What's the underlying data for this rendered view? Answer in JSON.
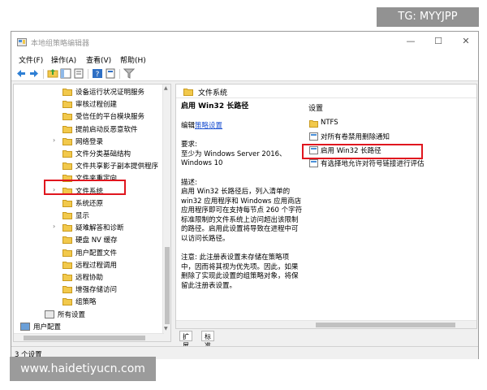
{
  "watermarks": {
    "top": "TG: MYYJPP",
    "bottom": "www.haidetiyucn.com"
  },
  "window": {
    "title": "本地组策略编辑器"
  },
  "menu": [
    "文件(F)",
    "操作(A)",
    "查看(V)",
    "帮助(H)"
  ],
  "tree": {
    "items": [
      {
        "label": "设备运行状况证明服务",
        "arrow": ""
      },
      {
        "label": "审核过程创建",
        "arrow": ""
      },
      {
        "label": "受信任的平台模块服务",
        "arrow": ""
      },
      {
        "label": "提前启动反恶意软件",
        "arrow": ""
      },
      {
        "label": "网络登录",
        "arrow": ">"
      },
      {
        "label": "文件分类基础结构",
        "arrow": ""
      },
      {
        "label": "文件共享影子副本提供程序",
        "arrow": ""
      },
      {
        "label": "文件夹重定向",
        "arrow": ""
      },
      {
        "label": "文件系统",
        "arrow": ">"
      },
      {
        "label": "系统还原",
        "arrow": ""
      },
      {
        "label": "显示",
        "arrow": ""
      },
      {
        "label": "疑难解答和诊断",
        "arrow": ">"
      },
      {
        "label": "硬盘 NV 缓存",
        "arrow": ""
      },
      {
        "label": "用户配置文件",
        "arrow": ""
      },
      {
        "label": "远程过程调用",
        "arrow": ""
      },
      {
        "label": "远程协助",
        "arrow": ""
      },
      {
        "label": "增强存储访问",
        "arrow": ""
      },
      {
        "label": "组策略",
        "arrow": ""
      },
      {
        "label": "所有设置",
        "arrow": ""
      },
      {
        "label": "用户配置",
        "arrow": ">"
      }
    ]
  },
  "right": {
    "header": "文件系统",
    "policy_title": "启用 Win32 长路径",
    "edit_prefix": "编辑",
    "edit_link": "策略设置",
    "req_label": "要求:",
    "req_text": "至少为 Windows Server 2016、Windows 10",
    "desc_label": "描述:",
    "desc_text": "启用 Win32 长路径后，列入清单的 win32 应用程序和 Windows 应用商店应用程序即可在支持每节点 260 个字符标准限制的文件系统上访问超出该限制的路径。启用此设置将导致在进程中可以访问长路径。",
    "note_text": "注意: 此注册表设置未存储在策略项中，因而将其视为优先项。因此，如果删除了实现此设置的组策略对象，将保留此注册表设置。",
    "settings_head": "设置",
    "settings": [
      "NTFS",
      "对所有卷禁用删除通知",
      "启用 Win32 长路径",
      "有选择地允许对符号链接进行评估"
    ]
  },
  "tabs": [
    "扩展",
    "标准"
  ],
  "status": "3 个设置",
  "colors": {
    "highlight_red": "#e0161e",
    "link_blue": "#1a4fd0",
    "folder_yellow": "#f2c94c"
  }
}
